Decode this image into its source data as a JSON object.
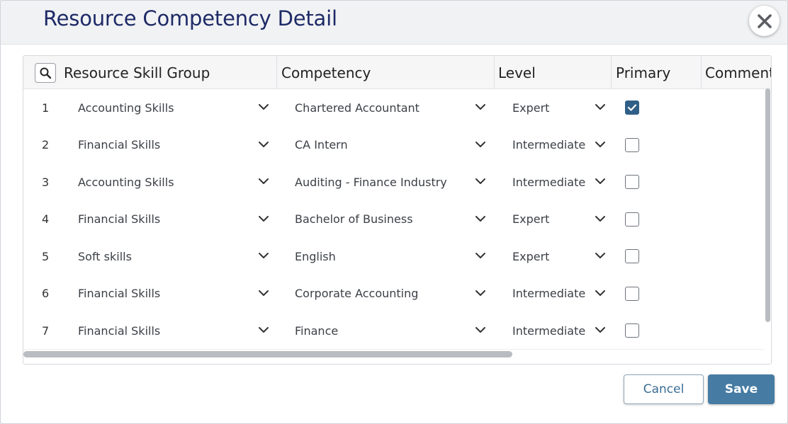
{
  "dialog": {
    "title": "Resource Competency Detail",
    "close_icon": "close-icon"
  },
  "grid": {
    "search_icon": "search-icon",
    "columns": [
      "Resource Skill Group",
      "Competency",
      "Level",
      "Primary",
      "Comment"
    ],
    "rows": [
      {
        "num": "1",
        "skill_group": "Accounting Skills",
        "competency": "Chartered Accountant",
        "level": "Expert",
        "primary": true
      },
      {
        "num": "2",
        "skill_group": "Financial Skills",
        "competency": "CA Intern",
        "level": "Intermediate",
        "primary": false
      },
      {
        "num": "3",
        "skill_group": "Accounting Skills",
        "competency": "Auditing - Finance Industry",
        "level": "Intermediate",
        "primary": false
      },
      {
        "num": "4",
        "skill_group": "Financial Skills",
        "competency": "Bachelor of Business",
        "level": "Expert",
        "primary": false
      },
      {
        "num": "5",
        "skill_group": "Soft skills",
        "competency": "English",
        "level": "Expert",
        "primary": false
      },
      {
        "num": "6",
        "skill_group": "Financial Skills",
        "competency": "Corporate Accounting",
        "level": "Intermediate",
        "primary": false
      },
      {
        "num": "7",
        "skill_group": "Financial Skills",
        "competency": "Finance",
        "level": "Intermediate",
        "primary": false
      }
    ]
  },
  "footer": {
    "cancel_label": "Cancel",
    "save_label": "Save"
  },
  "colors": {
    "title": "#1d2a66",
    "accent": "#467ba3",
    "checkbox_checked": "#2f5f86"
  }
}
